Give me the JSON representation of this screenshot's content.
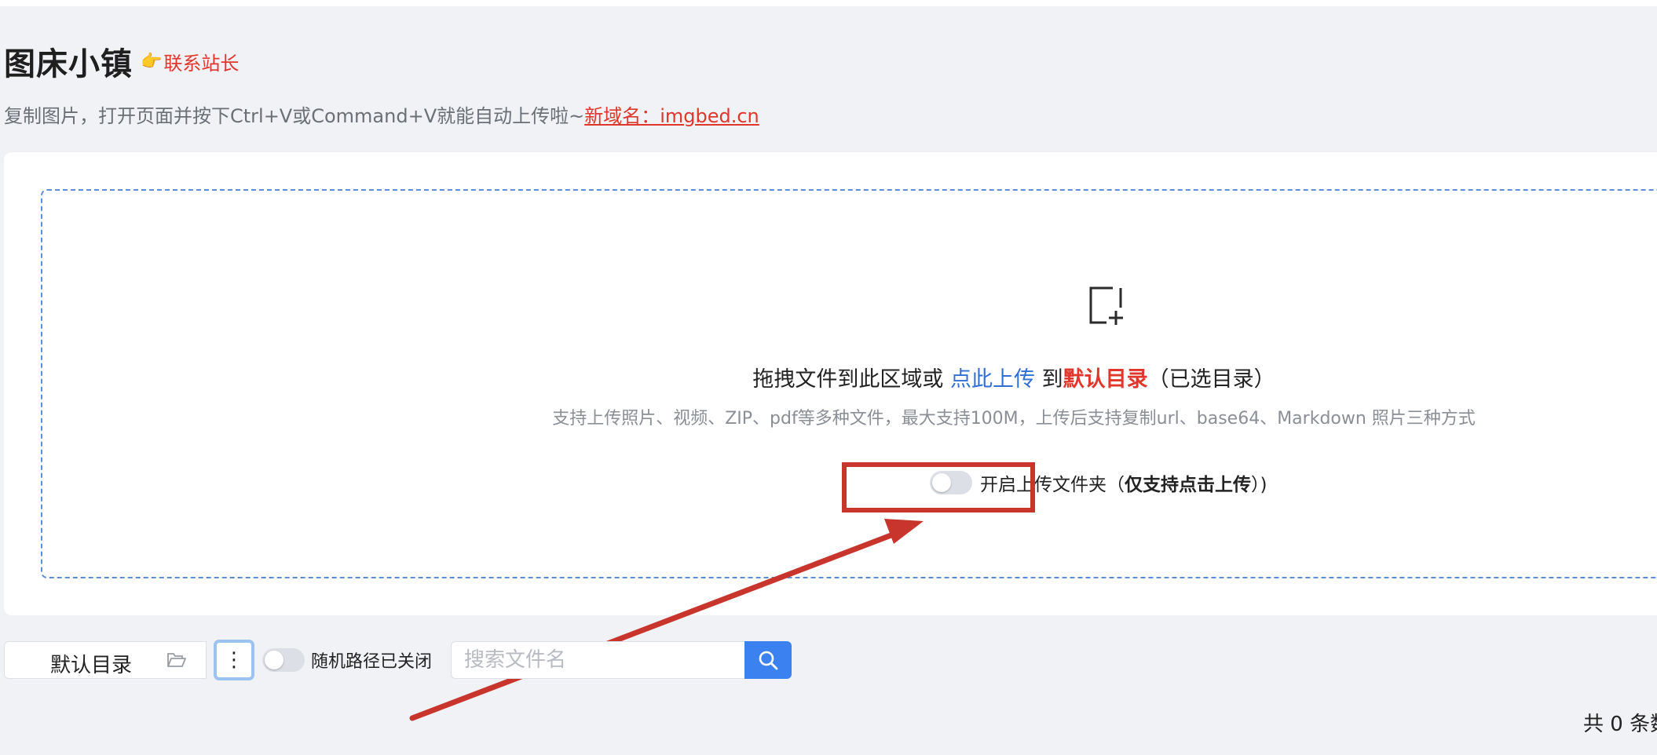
{
  "header": {
    "title": "图床小镇",
    "contact_icon": "👉",
    "contact_label": "联系站长",
    "subtitle_text": "复制图片，打开页面并按下Ctrl+V或Command+V就能自动上传啦~",
    "subtitle_domain": "新域名：imgbed.cn"
  },
  "upload": {
    "icon": "add-file-icon",
    "prefix": "拖拽文件到此区域或 ",
    "link": "点此上传",
    "mid": " 到",
    "dir": "默认目录",
    "suffix": "（已选目录）",
    "hint": "支持上传照片、视频、ZIP、pdf等多种文件，最大支持100M，上传后支持复制url、base64、Markdown 照片三种方式",
    "folder_toggle_label": "开启上传文件夹（",
    "folder_toggle_bold": "仅支持点击上传",
    "folder_toggle_suffix": "）)",
    "folder_toggle_on": false
  },
  "toolbar": {
    "directory": "默认目录",
    "more_label": "⋮",
    "random_path_label": "随机路径已关闭",
    "random_path_on": false,
    "search_placeholder": "搜索文件名"
  },
  "footer": {
    "total": "共 0 条数"
  },
  "colors": {
    "accent_blue": "#3b82f0",
    "accent_red": "#e0362b",
    "annotation_red": "#c8352c"
  }
}
